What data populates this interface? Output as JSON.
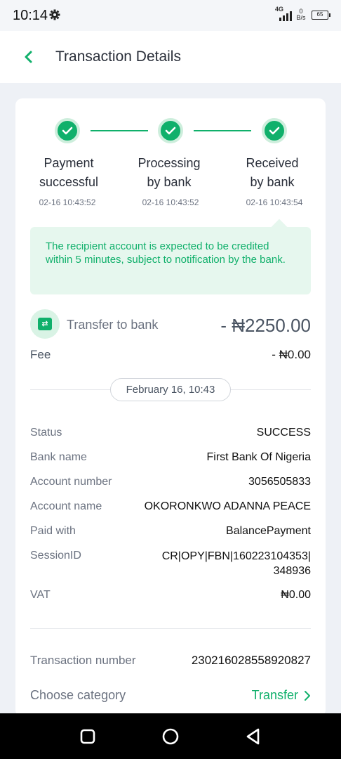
{
  "status_bar": {
    "time": "10:14",
    "network": "4G",
    "speed_value": "0",
    "speed_unit": "B/s",
    "battery": "65"
  },
  "header": {
    "title": "Transaction Details"
  },
  "steps": [
    {
      "line1": "Payment",
      "line2": "successful",
      "time": "02-16 10:43:52"
    },
    {
      "line1": "Processing",
      "line2": "by bank",
      "time": "02-16 10:43:52"
    },
    {
      "line1": "Received",
      "line2": "by bank",
      "time": "02-16 10:43:54"
    }
  ],
  "notice": "The recipient account is expected to be credited within 5 minutes, subject to notification by the bank.",
  "transfer": {
    "label": "Transfer to bank",
    "amount": "- ₦2250.00",
    "fee_label": "Fee",
    "fee_value": "- ₦0.00"
  },
  "date_pill": "February 16, 10:43",
  "details": {
    "status_label": "Status",
    "status_value": "SUCCESS",
    "bank_label": "Bank name",
    "bank_value": "First Bank Of Nigeria",
    "account_number_label": "Account number",
    "account_number_value": "3056505833",
    "account_name_label": "Account name",
    "account_name_value": "OKORONKWO ADANNA PEACE",
    "paid_with_label": "Paid with",
    "paid_with_value": "BalancePayment",
    "session_label": "SessionID",
    "session_value_line1": "CR|OPY|FBN|160223104353|",
    "session_value_line2": "348936",
    "vat_label": "VAT",
    "vat_value": "₦0.00"
  },
  "transaction": {
    "number_label": "Transaction number",
    "number_value": "230216028558920827",
    "category_label": "Choose category",
    "category_value": "Transfer"
  },
  "colors": {
    "accent": "#10b06b",
    "background": "#eef1f6",
    "notice_bg": "#e6f7ee"
  }
}
